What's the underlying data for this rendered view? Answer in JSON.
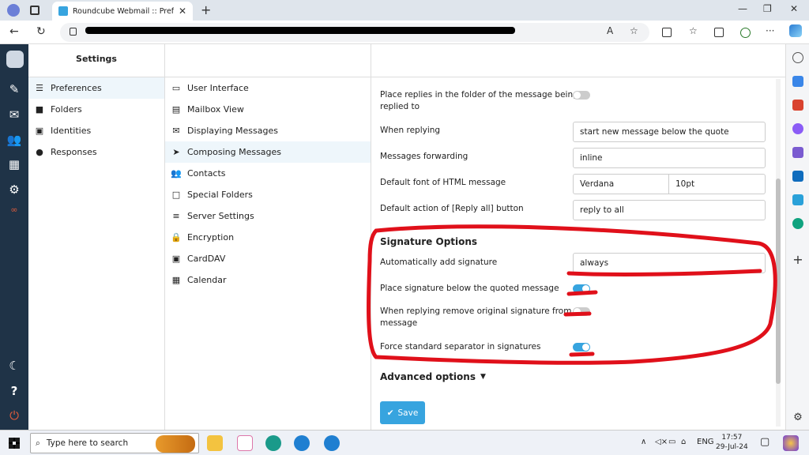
{
  "browser": {
    "tab_title": "Roundcube Webmail :: Preferenc",
    "tab_close": "✕",
    "new_tab": "+",
    "min": "—",
    "restore": "❐",
    "close": "✕",
    "back": "←",
    "refresh": "↻",
    "reader": "A",
    "fav": "☆",
    "more": "···"
  },
  "app": {
    "settings_title": "Settings",
    "sections": [
      {
        "label": "Preferences",
        "icon": "sliders-icon"
      },
      {
        "label": "Folders",
        "icon": "folder-icon"
      },
      {
        "label": "Identities",
        "icon": "id-card-icon"
      },
      {
        "label": "Responses",
        "icon": "comment-icon"
      }
    ],
    "prefs": [
      {
        "label": "User Interface",
        "icon": "monitor-icon"
      },
      {
        "label": "Mailbox View",
        "icon": "mailbox-icon"
      },
      {
        "label": "Displaying Messages",
        "icon": "envelope-open-icon"
      },
      {
        "label": "Composing Messages",
        "icon": "paper-plane-icon"
      },
      {
        "label": "Contacts",
        "icon": "users-icon"
      },
      {
        "label": "Special Folders",
        "icon": "folder-outline-icon"
      },
      {
        "label": "Server Settings",
        "icon": "server-icon"
      },
      {
        "label": "Encryption",
        "icon": "lock-icon"
      },
      {
        "label": "CardDAV",
        "icon": "address-card-icon"
      },
      {
        "label": "Calendar",
        "icon": "calendar-icon"
      }
    ]
  },
  "form": {
    "place_replies_l1": "Place replies in the folder of the message being",
    "place_replies_l2": "replied to",
    "when_replying": "When replying",
    "when_replying_value": "start new message below the quote",
    "forwarding": "Messages forwarding",
    "forwarding_value": "inline",
    "font": "Default font of HTML message",
    "font_value": "Verdana",
    "font_size": "10pt",
    "reply_all": "Default action of [Reply all] button",
    "reply_all_value": "reply to all",
    "signature_header": "Signature Options",
    "auto_sig": "Automatically add signature",
    "auto_sig_value": "always",
    "sig_below": "Place signature below the quoted message",
    "remove_sig_l1": "When replying remove original signature from",
    "remove_sig_l2": "message",
    "force_sep": "Force standard separator in signatures",
    "advanced": "Advanced options",
    "save": "Save",
    "toggles": {
      "place_replies": false,
      "sig_below": true,
      "remove_sig": false,
      "force_sep": true
    }
  },
  "taskbar": {
    "search_placeholder": "Type here to search",
    "lang": "ENG",
    "time": "17:57",
    "date": "29-Jul-24"
  }
}
